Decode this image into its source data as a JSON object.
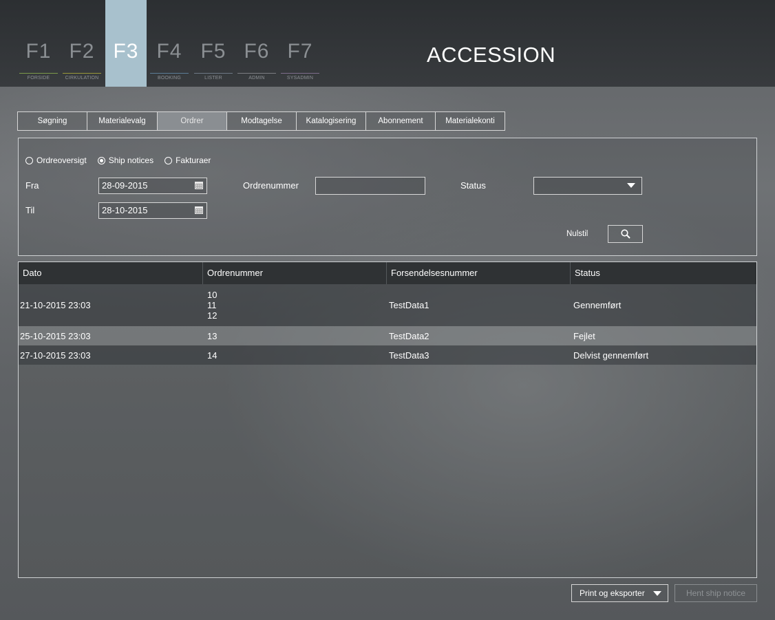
{
  "fkeys": [
    {
      "key": "F1",
      "label": "FORSIDE",
      "color": "#7d9b4a"
    },
    {
      "key": "F2",
      "label": "CIRKULATION",
      "color": "#9a9a3a"
    },
    {
      "key": "F3",
      "label": "",
      "color": "#a8c1cd"
    },
    {
      "key": "F4",
      "label": "BOOKING",
      "color": "#5c7f98"
    },
    {
      "key": "F5",
      "label": "LISTER",
      "color": "#6f7a86"
    },
    {
      "key": "F6",
      "label": "ADMIN",
      "color": "#7d7f83"
    },
    {
      "key": "F7",
      "label": "SYSADMIN",
      "color": "#7f6e8c"
    }
  ],
  "app_title": "ACCESSION",
  "tabs": [
    "Søgning",
    "Materialevalg",
    "Ordrer",
    "Modtagelse",
    "Katalogisering",
    "Abonnement",
    "Materialekonti"
  ],
  "active_tab": "Ordrer",
  "filter": {
    "radios": [
      {
        "label": "Ordreoversigt",
        "checked": false
      },
      {
        "label": "Ship notices",
        "checked": true
      },
      {
        "label": "Fakturaer",
        "checked": false
      }
    ],
    "fra_label": "Fra",
    "fra_value": "28-09-2015",
    "til_label": "Til",
    "til_value": "28-10-2015",
    "ordrenummer_label": "Ordrenummer",
    "ordrenummer_value": "",
    "status_label": "Status",
    "status_value": "",
    "reset_label": "Nulstil"
  },
  "table": {
    "headers": [
      "Dato",
      "Ordrenummer",
      "Forsendelsesnummer",
      "Status"
    ],
    "rows": [
      {
        "dato": "21-10-2015 23:03",
        "ordrenumre": [
          "10",
          "11",
          "12"
        ],
        "forsendelse": "TestData1",
        "status": "Gennemført"
      },
      {
        "dato": "25-10-2015 23:03",
        "ordrenumre": [
          "13"
        ],
        "forsendelse": "TestData2",
        "status": "Fejlet"
      },
      {
        "dato": "27-10-2015 23:03",
        "ordrenumre": [
          "14"
        ],
        "forsendelse": "TestData3",
        "status": "Delvist gennemført"
      }
    ]
  },
  "footer": {
    "print_label": "Print og eksporter",
    "fetch_label": "Hent ship notice"
  }
}
